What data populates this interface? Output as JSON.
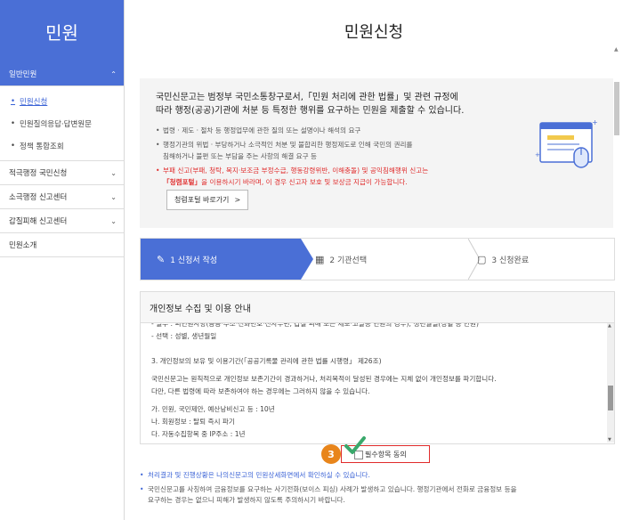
{
  "sidebar": {
    "title": "민원",
    "items": [
      {
        "label": "일반민원",
        "active": true
      },
      {
        "label": "적극행정 국민신청"
      },
      {
        "label": "소극행정 신고센터"
      },
      {
        "label": "갑질피해 신고센터"
      },
      {
        "label": "민원소개"
      }
    ],
    "sub_items": [
      "민원신청",
      "민원질의응답·답변원문",
      "정책 통합조회"
    ]
  },
  "page": {
    "title": "민원신청"
  },
  "notice": {
    "lead_line1": "국민신문고는 범정부 국민소통창구로서,「민원 처리에 관한 법률」및 관련 규정에",
    "lead_line2": "따라 행정(공공)기관에 처분 등 특정한 행위를 요구하는 민원을 제출할 수 있습니다.",
    "bullet1": "법령 · 제도 · 절차 등 행정업무에 관한 질의 또는 설명이나 해석의 요구",
    "bullet2_line1": "행정기관의 위법 · 부당하거나 소극적인 처분 및 불합리한 행정제도로 인해 국민의 권리를",
    "bullet2_line2": "침해하거나 불편 또는 부담을 주는 사항의 해결 요구 등",
    "bullet3_line1": "부패 신고(부패, 청탁, 복지·보조금 부정수급, 행동강령위반, 이해충돌) 및 공익침해행위 신고는",
    "bullet3_strong": "「청렴포털」",
    "bullet3_line2": "을 이용하시기 바라며, 이 경우 신고자 보호 및 보상금 지급이 가능합니다.",
    "portal_button": "청렴포털 바로가기"
  },
  "steps": {
    "step1": "1 신청서 작성",
    "step2": "2 기관선택",
    "step3": "3 신청완료"
  },
  "privacy": {
    "heading": "개인정보 수집 및 이용 안내",
    "lines": [
      "- 필수 : 피민원사항(공공·주소·전화번호·전자우편, 갑질 피해 또는 제보·고발등 민원의 경우), 생년월일(성별 등 만원)",
      "- 선택 : 성별, 생년월일",
      "",
      "3. 개인정보의 보유 및 이용기간(「공공기록물 관리에 관한 법률 시행령」 제26조)",
      "",
      "국민신문고는 원칙적으로 개인정보 보존기간이 경과하거나, 처리목적이 달성된 경우에는 지체 없이 개인정보를 파기합니다.",
      "다만, 다른 법령에 따라 보존하여야 하는 경우에는 그러하지 않을 수 있습니다.",
      "",
      "가. 민원, 국민제안, 예산낭비신고 등 : 10년",
      "나. 회원정보 : 탈퇴 즉시 파기",
      "다. 자동수집항목 중 IP주소 : 1년"
    ]
  },
  "agree": {
    "label": "필수항목 동의",
    "badge": "3"
  },
  "footer": {
    "note1": "처리결과 및 진행상황은 나의신문고의 민원상세화면에서 확인하실 수 있습니다.",
    "note2_line1": "국민신문고를 사칭하여 금융정보를 요구하는 사기전화(보이스 피싱) 사례가 발생하고 있습니다. 행정기관에서 전화로 금융정보 등을",
    "note2_line2": "요구하는 경우는 없으니 피해가 발생하지 않도록 주의하시기 바랍니다."
  },
  "colors": {
    "brand": "#4a6fd6",
    "alert": "#e02b2b",
    "badge": "#e8851b",
    "check": "#3aa86b"
  }
}
